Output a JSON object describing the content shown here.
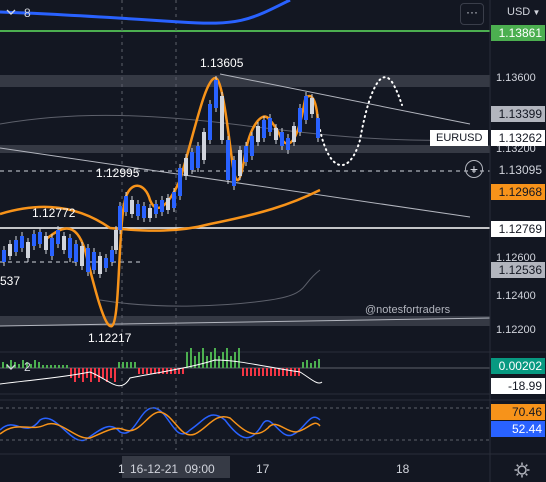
{
  "header": {
    "indicator_count": "8",
    "currency": "USD",
    "menu_icon": "more-dots-icon"
  },
  "sub_header": {
    "indicator_count": "2"
  },
  "watermark": "@notesfortraders",
  "symbol_label": "EURUSD",
  "price_scale": {
    "ticks": [
      "1.13600",
      "1.13200",
      "1.12600",
      "1.12400",
      "1.12200"
    ],
    "highlights": [
      {
        "text": "1.13861",
        "bg": "#4caf50",
        "fg": "#ffffff"
      },
      {
        "text": "1.13399",
        "bg": "#b2b5be",
        "fg": "#131722"
      },
      {
        "text": "1.13262",
        "bg": "#ffffff",
        "fg": "#131722"
      },
      {
        "text": "1.13095",
        "bg": "#131722",
        "fg": "#d1d4dc"
      },
      {
        "text": "1.12968",
        "bg": "#f7931a",
        "fg": "#131722"
      },
      {
        "text": "1.12769",
        "bg": "#ffffff",
        "fg": "#131722"
      },
      {
        "text": "1.12536",
        "bg": "#b2b5be",
        "fg": "#131722"
      }
    ]
  },
  "annotations": {
    "high": "1.13605",
    "swing1": "1.12995",
    "swing2": "1.12772",
    "low": "1.12217",
    "left_edge": "537"
  },
  "indicator1": {
    "value1": "0.00202",
    "value1_bg": "#089981",
    "value2": "-18.99",
    "value2_bg": "#ffffff"
  },
  "indicator2": {
    "value1": "70.46",
    "value1_bg": "#f7931a",
    "value2": "52.44",
    "value2_bg": "#2962ff"
  },
  "time_axis": {
    "start": "1",
    "current": "16-12-21  09:00",
    "d17": "17",
    "d18": "18"
  },
  "colors": {
    "up": "#2962ff",
    "down": "#d1d4dc",
    "orange": "#f7931a",
    "green": "#4caf50",
    "red": "#f23645"
  }
}
